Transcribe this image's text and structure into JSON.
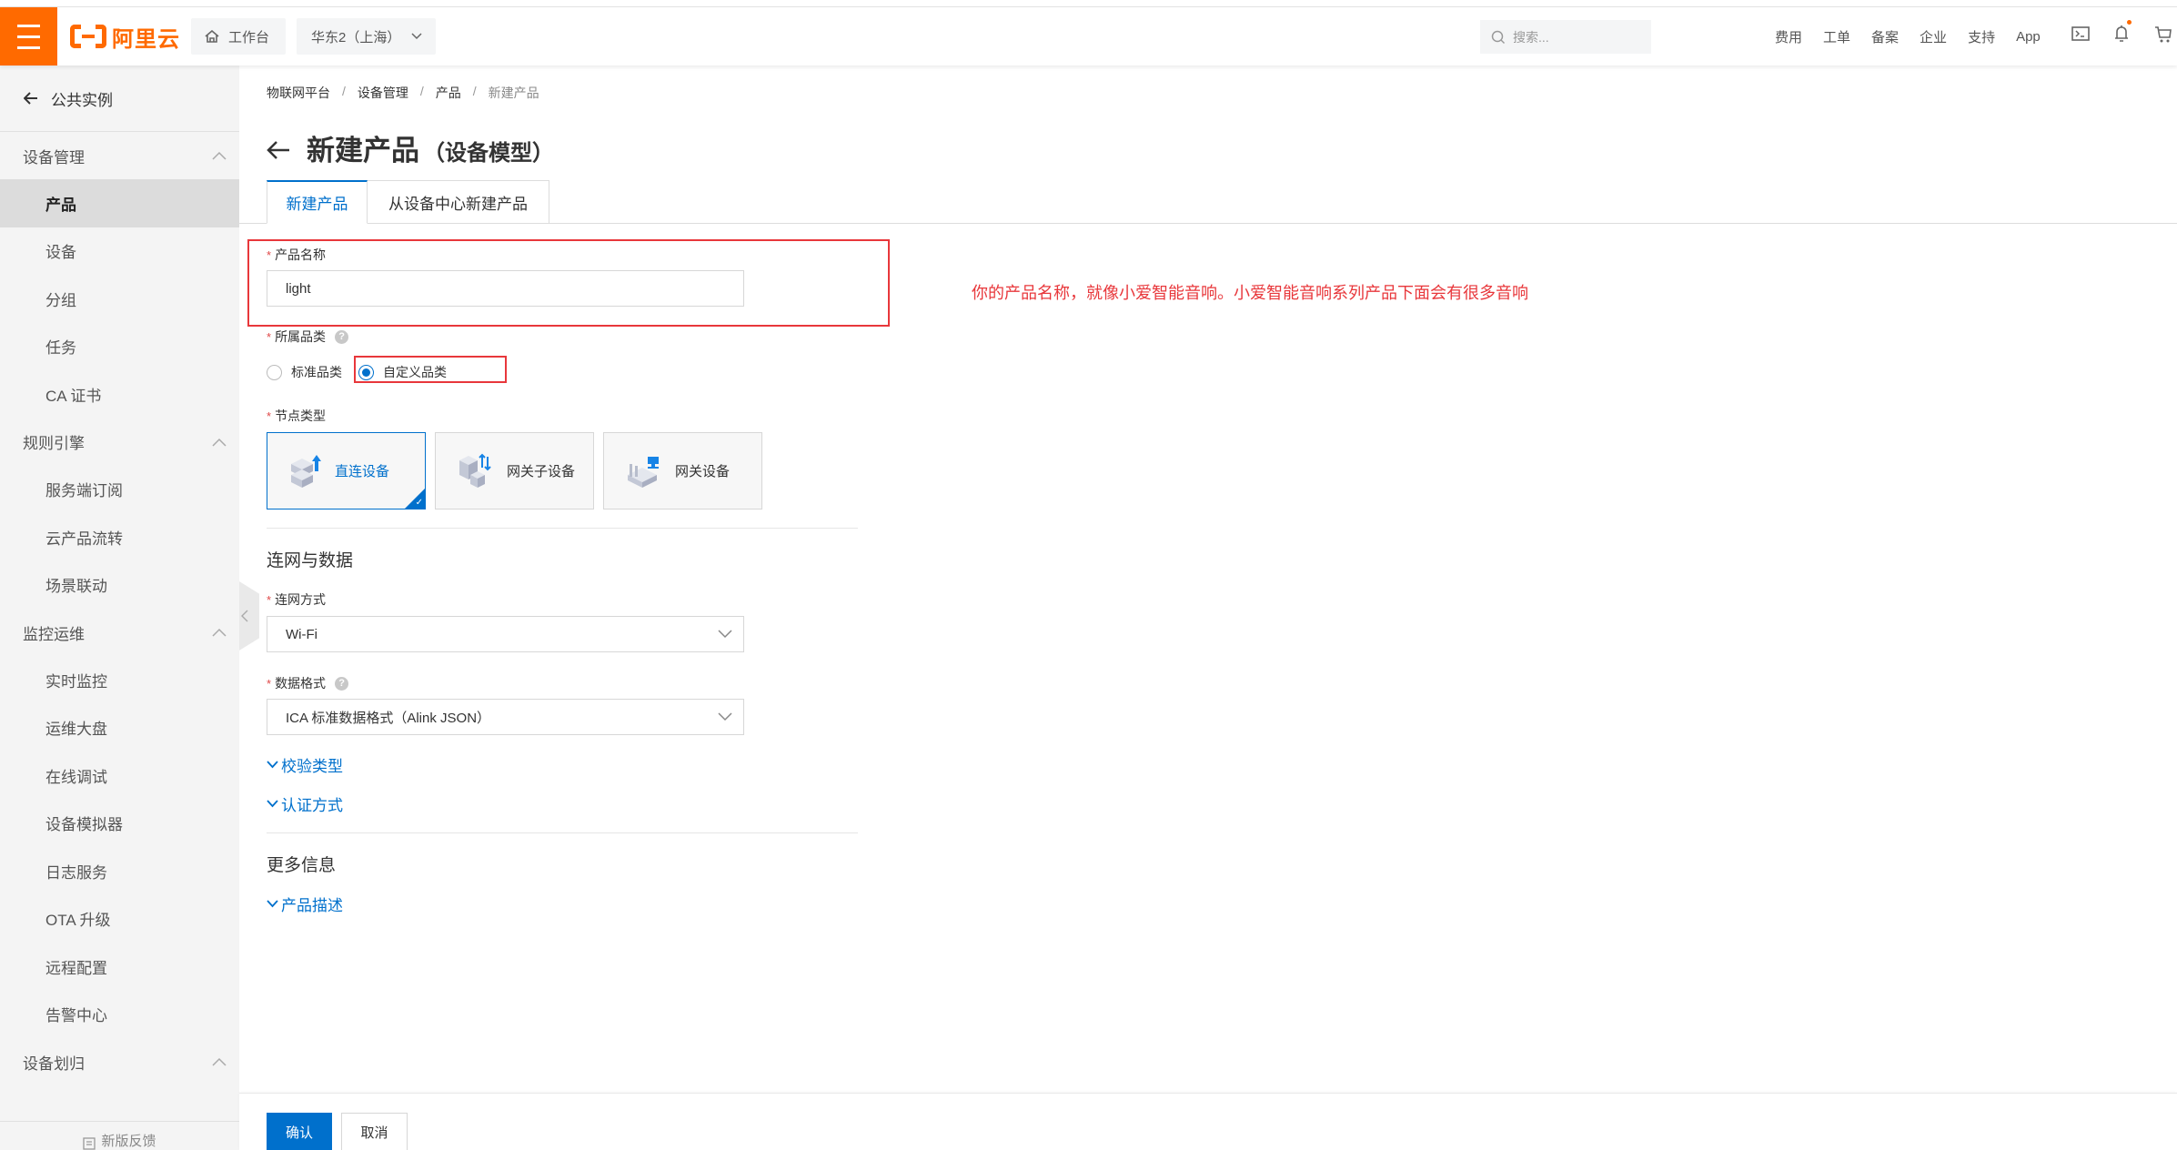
{
  "topbar": {
    "logo_text": "阿里云",
    "workbench_label": "工作台",
    "region_label": "华东2（上海）",
    "search_placeholder": "搜索...",
    "links": [
      "费用",
      "工单",
      "备案",
      "企业",
      "支持",
      "App"
    ],
    "icons": [
      "terminal-icon",
      "bell-icon",
      "cart-icon"
    ],
    "brand_color": "#ff6a00"
  },
  "sidebar": {
    "back_label": "公共实例",
    "groups": [
      {
        "label": "设备管理",
        "items": [
          "产品",
          "设备",
          "分组",
          "任务",
          "CA 证书"
        ]
      },
      {
        "label": "规则引擎",
        "items": [
          "服务端订阅",
          "云产品流转",
          "场景联动"
        ]
      },
      {
        "label": "监控运维",
        "items": [
          "实时监控",
          "运维大盘",
          "在线调试",
          "设备模拟器",
          "日志服务",
          "OTA 升级",
          "远程配置",
          "告警中心"
        ]
      },
      {
        "label": "设备划归",
        "items": []
      }
    ],
    "active_item": "产品",
    "feedback_label": "新版反馈"
  },
  "breadcrumb": [
    "物联网平台",
    "设备管理",
    "产品",
    "新建产品"
  ],
  "page": {
    "title": "新建产品",
    "subtitle": "（设备模型）"
  },
  "tabs": [
    {
      "label": "新建产品",
      "active": true
    },
    {
      "label": "从设备中心新建产品",
      "active": false
    }
  ],
  "form": {
    "product_name": {
      "label": "产品名称",
      "value": "light",
      "required": true
    },
    "category": {
      "label": "所属品类",
      "required": true,
      "options": [
        "标准品类",
        "自定义品类"
      ],
      "selected": "自定义品类"
    },
    "node_type": {
      "label": "节点类型",
      "required": true,
      "options": [
        "直连设备",
        "网关子设备",
        "网关设备"
      ],
      "selected": "直连设备"
    },
    "network_section_title": "连网与数据",
    "connection": {
      "label": "连网方式",
      "value": "Wi-Fi",
      "required": true
    },
    "data_format": {
      "label": "数据格式",
      "value": "ICA 标准数据格式（Alink JSON）",
      "required": true
    },
    "expanders": [
      "校验类型",
      "认证方式"
    ],
    "more_section_title": "更多信息",
    "more_expanders": [
      "产品描述"
    ]
  },
  "annotation": "你的产品名称，就像小爱智能音响。小爱智能音响系列产品下面会有很多音响",
  "footer": {
    "confirm_label": "确认",
    "cancel_label": "取消"
  },
  "colors": {
    "primary": "#0070cc",
    "annotation_red": "#e8373b"
  }
}
